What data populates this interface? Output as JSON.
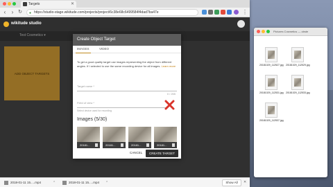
{
  "browser": {
    "tab_title": "Targets",
    "url": "https://studio-stage.wikitude.com/projects/project/6c38e68c6499584f4dad7ba47e",
    "downloads": [
      {
        "label": "2018-01-11 15.....mp4"
      },
      {
        "label": "2018-01-11 15.....mp4"
      }
    ],
    "show_all_label": "Show All"
  },
  "app": {
    "brand": "wikitude studio",
    "database_label": "Test Cosmetics",
    "add_target_label": "ADD OBJECT TARGETS"
  },
  "modal": {
    "title": "Create Object Target",
    "tabs": [
      {
        "label": "IMAGES"
      },
      {
        "label": "VIDEO"
      }
    ],
    "description": "To get a good quality target use images representing the object from different angles. If I selected to use the same recording device for all images.",
    "learn_more": "Learn more",
    "target_name_placeholder": "Target name *",
    "name_counter": "0 / 255",
    "field_of_view_placeholder": "Field of view *",
    "field_helper": "Select device used for recording",
    "images_heading": "Images (5/30)",
    "thumbnails": [
      {
        "name": "20181..."
      },
      {
        "name": "20181..."
      },
      {
        "name": "20181..."
      },
      {
        "name": "20181..."
      }
    ],
    "cancel_label": "CANCEL",
    "create_label": "CREATE TARGET"
  },
  "finder": {
    "title": "Pictures Cosmetics — obste",
    "files": [
      {
        "name": "20181029_112527.jpg"
      },
      {
        "name": "20181029_112529.jpg"
      },
      {
        "name": "20181029_112531.jpg"
      },
      {
        "name": "20181029_112533.jpg"
      },
      {
        "name": "20181029_112537.jpg"
      }
    ]
  },
  "colors": {
    "accent": "#e3a93a",
    "error": "#d9342b",
    "header": "#2f2f2f"
  }
}
